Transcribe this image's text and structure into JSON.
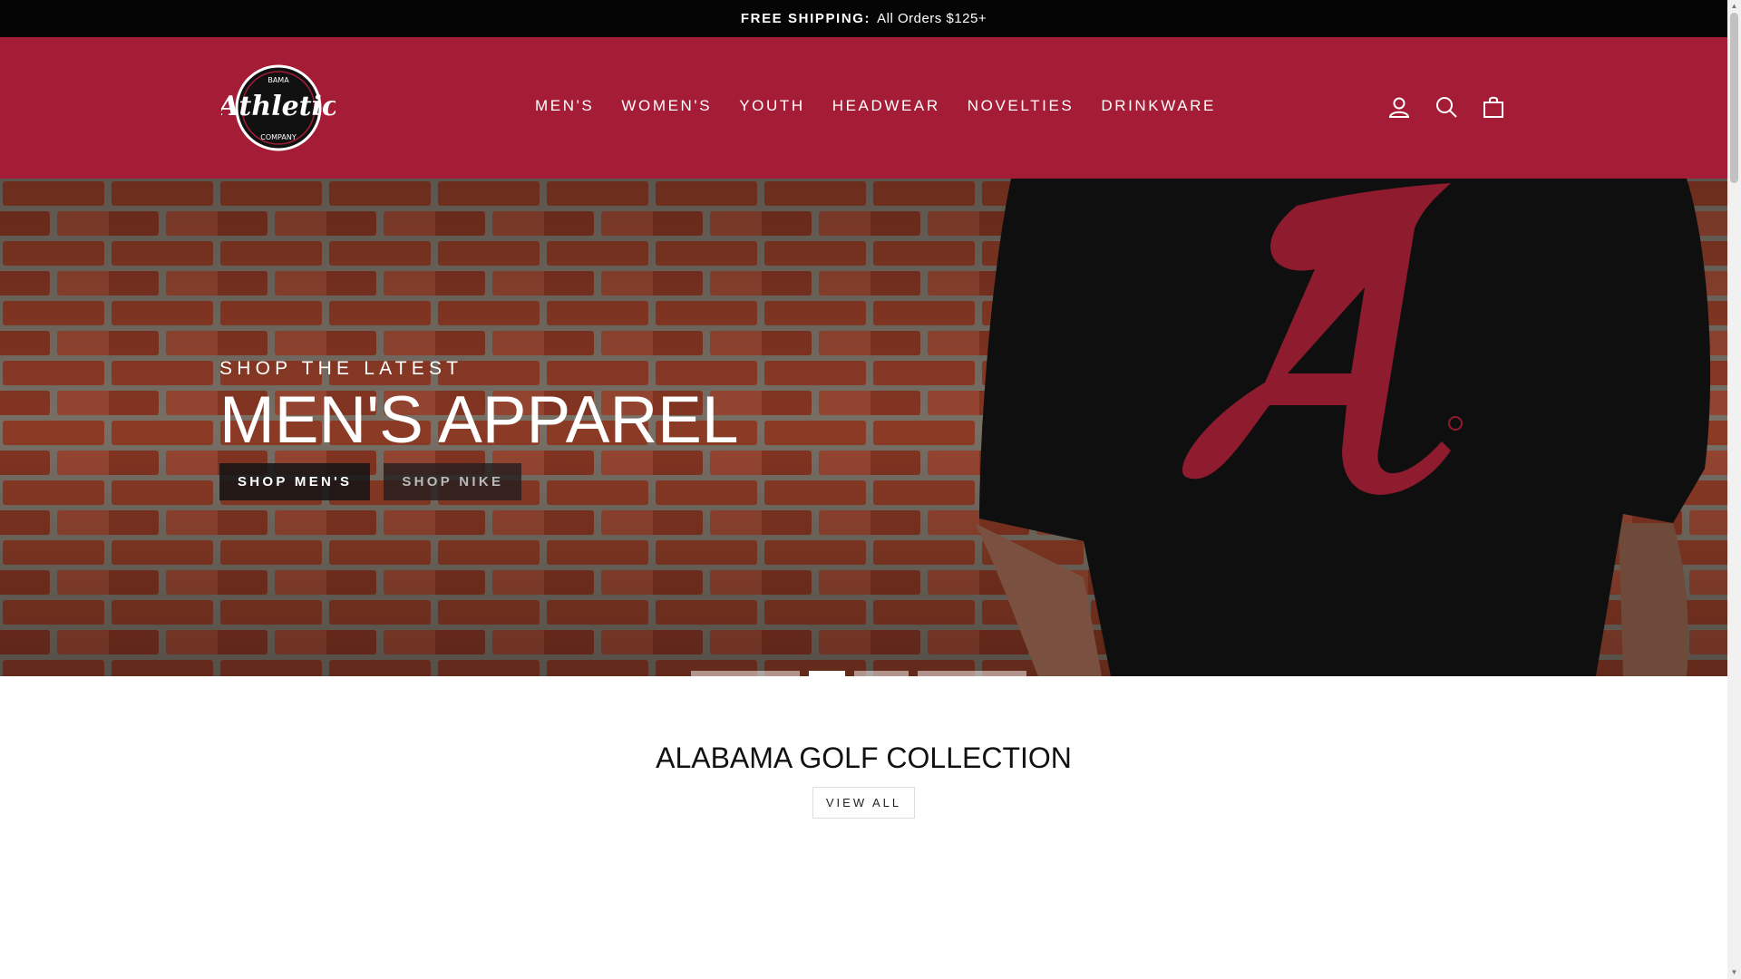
{
  "announcement": {
    "bold": "FREE SHIPPING:",
    "text": "All Orders $125+"
  },
  "brand": {
    "logo_top": "BAMA",
    "logo_main": "Athletic",
    "logo_bottom": "COMPANY"
  },
  "nav": [
    {
      "label": "MEN'S"
    },
    {
      "label": "WOMEN'S"
    },
    {
      "label": "YOUTH"
    },
    {
      "label": "HEADWEAR"
    },
    {
      "label": "NOVELTIES"
    },
    {
      "label": "DRINKWARE"
    }
  ],
  "header_icons": [
    "user-icon",
    "search-icon",
    "bag-icon"
  ],
  "hero": {
    "subtitle": "SHOP THE LATEST",
    "title": "MEN'S APPAREL",
    "buttons": [
      {
        "label": "SHOP MEN'S"
      },
      {
        "label": "SHOP NIKE"
      }
    ]
  },
  "carousel": {
    "slides": 4,
    "active_index": 1
  },
  "collection": {
    "title": "ALABAMA GOLF COLLECTION",
    "cta": "VIEW ALL"
  },
  "colors": {
    "brand_red": "#a51c36",
    "announcement_bg": "#050505",
    "shirt": "#0f0f0f",
    "logo_red": "#a51c36"
  }
}
